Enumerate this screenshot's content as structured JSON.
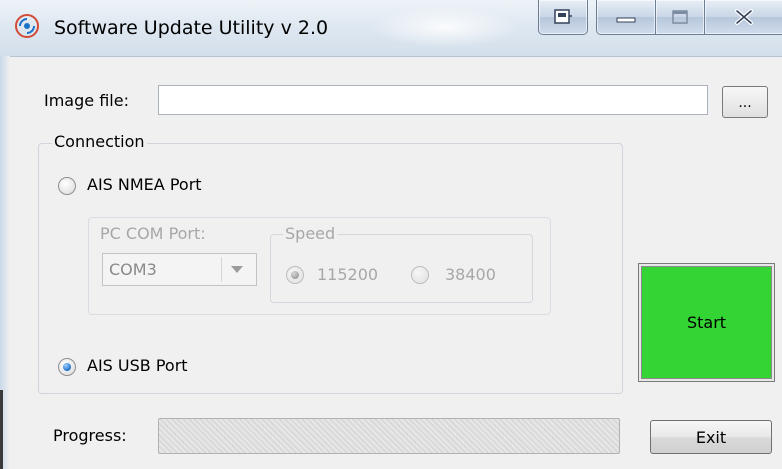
{
  "window": {
    "title": "Software Update Utility v 2.0",
    "app_icon": "update-signal-icon",
    "controls": [
      "system-menu-icon",
      "minimize-icon",
      "maximize-icon",
      "close-icon"
    ]
  },
  "image_file": {
    "label": "Image file:",
    "value": "",
    "browse_label": "..."
  },
  "connection": {
    "legend": "Connection",
    "nmea_label": "AIS NMEA Port",
    "nmea_selected": false,
    "pc_com_port": {
      "label": "PC COM Port:",
      "value": "COM3"
    },
    "speed": {
      "legend": "Speed",
      "options": [
        "115200",
        "38400"
      ],
      "selected": "115200"
    },
    "usb_label": "AIS USB Port",
    "usb_selected": true
  },
  "start_label": "Start",
  "progress": {
    "label": "Progress:",
    "value_percent": 0
  },
  "exit_label": "Exit",
  "colors": {
    "start_button": "#33d433",
    "titlebar": "#dfe8f1",
    "window_bg": "#f0f0f0"
  }
}
